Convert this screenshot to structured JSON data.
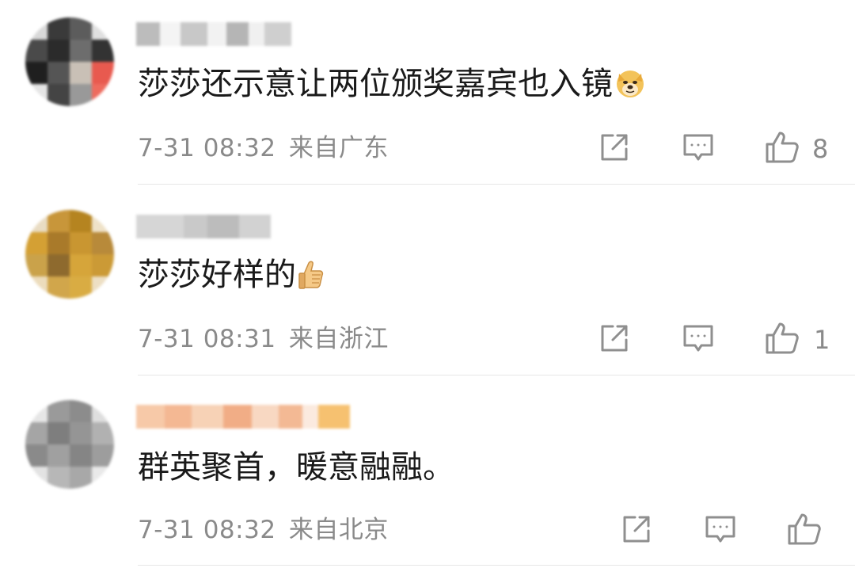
{
  "comments": [
    {
      "text": "莎莎还示意让两位颁奖嘉宾也入镜",
      "emoji": "doge-emoji",
      "timestamp": "7-31 08:32",
      "location": "来自广东",
      "like_count": "8"
    },
    {
      "text": "莎莎好样的",
      "emoji": "thumbs-up-emoji",
      "timestamp": "7-31 08:31",
      "location": "来自浙江",
      "like_count": "1"
    },
    {
      "text": "群英聚首，暖意融融。",
      "emoji": "",
      "timestamp": "7-31 08:32",
      "location": "来自北京",
      "like_count": ""
    }
  ],
  "colors": {
    "text": "#1a1a1a",
    "meta": "#8a8a8a",
    "icon": "#8f8f8f",
    "divider": "#e6e6e6"
  },
  "icons": [
    "share-icon",
    "reply-icon",
    "like-icon"
  ]
}
